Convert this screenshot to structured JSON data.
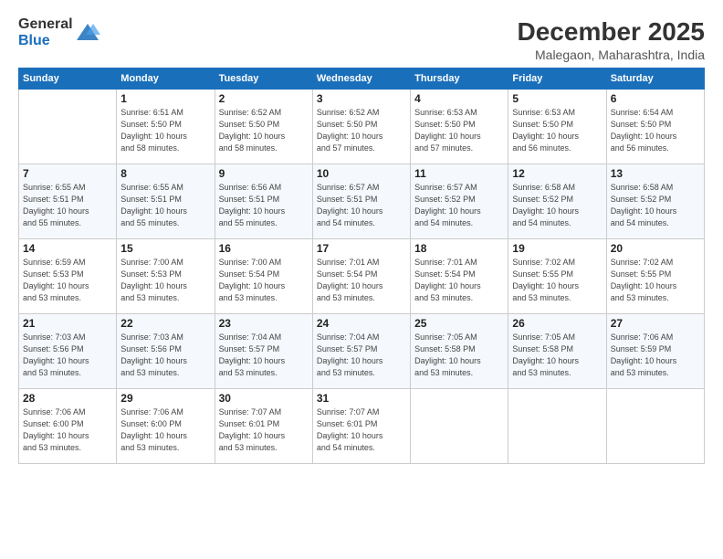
{
  "logo": {
    "general": "General",
    "blue": "Blue"
  },
  "header": {
    "month": "December 2025",
    "location": "Malegaon, Maharashtra, India"
  },
  "weekdays": [
    "Sunday",
    "Monday",
    "Tuesday",
    "Wednesday",
    "Thursday",
    "Friday",
    "Saturday"
  ],
  "weeks": [
    [
      {
        "day": "",
        "info": ""
      },
      {
        "day": "1",
        "info": "Sunrise: 6:51 AM\nSunset: 5:50 PM\nDaylight: 10 hours\nand 58 minutes."
      },
      {
        "day": "2",
        "info": "Sunrise: 6:52 AM\nSunset: 5:50 PM\nDaylight: 10 hours\nand 58 minutes."
      },
      {
        "day": "3",
        "info": "Sunrise: 6:52 AM\nSunset: 5:50 PM\nDaylight: 10 hours\nand 57 minutes."
      },
      {
        "day": "4",
        "info": "Sunrise: 6:53 AM\nSunset: 5:50 PM\nDaylight: 10 hours\nand 57 minutes."
      },
      {
        "day": "5",
        "info": "Sunrise: 6:53 AM\nSunset: 5:50 PM\nDaylight: 10 hours\nand 56 minutes."
      },
      {
        "day": "6",
        "info": "Sunrise: 6:54 AM\nSunset: 5:50 PM\nDaylight: 10 hours\nand 56 minutes."
      }
    ],
    [
      {
        "day": "7",
        "info": "Sunrise: 6:55 AM\nSunset: 5:51 PM\nDaylight: 10 hours\nand 55 minutes."
      },
      {
        "day": "8",
        "info": "Sunrise: 6:55 AM\nSunset: 5:51 PM\nDaylight: 10 hours\nand 55 minutes."
      },
      {
        "day": "9",
        "info": "Sunrise: 6:56 AM\nSunset: 5:51 PM\nDaylight: 10 hours\nand 55 minutes."
      },
      {
        "day": "10",
        "info": "Sunrise: 6:57 AM\nSunset: 5:51 PM\nDaylight: 10 hours\nand 54 minutes."
      },
      {
        "day": "11",
        "info": "Sunrise: 6:57 AM\nSunset: 5:52 PM\nDaylight: 10 hours\nand 54 minutes."
      },
      {
        "day": "12",
        "info": "Sunrise: 6:58 AM\nSunset: 5:52 PM\nDaylight: 10 hours\nand 54 minutes."
      },
      {
        "day": "13",
        "info": "Sunrise: 6:58 AM\nSunset: 5:52 PM\nDaylight: 10 hours\nand 54 minutes."
      }
    ],
    [
      {
        "day": "14",
        "info": "Sunrise: 6:59 AM\nSunset: 5:53 PM\nDaylight: 10 hours\nand 53 minutes."
      },
      {
        "day": "15",
        "info": "Sunrise: 7:00 AM\nSunset: 5:53 PM\nDaylight: 10 hours\nand 53 minutes."
      },
      {
        "day": "16",
        "info": "Sunrise: 7:00 AM\nSunset: 5:54 PM\nDaylight: 10 hours\nand 53 minutes."
      },
      {
        "day": "17",
        "info": "Sunrise: 7:01 AM\nSunset: 5:54 PM\nDaylight: 10 hours\nand 53 minutes."
      },
      {
        "day": "18",
        "info": "Sunrise: 7:01 AM\nSunset: 5:54 PM\nDaylight: 10 hours\nand 53 minutes."
      },
      {
        "day": "19",
        "info": "Sunrise: 7:02 AM\nSunset: 5:55 PM\nDaylight: 10 hours\nand 53 minutes."
      },
      {
        "day": "20",
        "info": "Sunrise: 7:02 AM\nSunset: 5:55 PM\nDaylight: 10 hours\nand 53 minutes."
      }
    ],
    [
      {
        "day": "21",
        "info": "Sunrise: 7:03 AM\nSunset: 5:56 PM\nDaylight: 10 hours\nand 53 minutes."
      },
      {
        "day": "22",
        "info": "Sunrise: 7:03 AM\nSunset: 5:56 PM\nDaylight: 10 hours\nand 53 minutes."
      },
      {
        "day": "23",
        "info": "Sunrise: 7:04 AM\nSunset: 5:57 PM\nDaylight: 10 hours\nand 53 minutes."
      },
      {
        "day": "24",
        "info": "Sunrise: 7:04 AM\nSunset: 5:57 PM\nDaylight: 10 hours\nand 53 minutes."
      },
      {
        "day": "25",
        "info": "Sunrise: 7:05 AM\nSunset: 5:58 PM\nDaylight: 10 hours\nand 53 minutes."
      },
      {
        "day": "26",
        "info": "Sunrise: 7:05 AM\nSunset: 5:58 PM\nDaylight: 10 hours\nand 53 minutes."
      },
      {
        "day": "27",
        "info": "Sunrise: 7:06 AM\nSunset: 5:59 PM\nDaylight: 10 hours\nand 53 minutes."
      }
    ],
    [
      {
        "day": "28",
        "info": "Sunrise: 7:06 AM\nSunset: 6:00 PM\nDaylight: 10 hours\nand 53 minutes."
      },
      {
        "day": "29",
        "info": "Sunrise: 7:06 AM\nSunset: 6:00 PM\nDaylight: 10 hours\nand 53 minutes."
      },
      {
        "day": "30",
        "info": "Sunrise: 7:07 AM\nSunset: 6:01 PM\nDaylight: 10 hours\nand 53 minutes."
      },
      {
        "day": "31",
        "info": "Sunrise: 7:07 AM\nSunset: 6:01 PM\nDaylight: 10 hours\nand 54 minutes."
      },
      {
        "day": "",
        "info": ""
      },
      {
        "day": "",
        "info": ""
      },
      {
        "day": "",
        "info": ""
      }
    ]
  ]
}
